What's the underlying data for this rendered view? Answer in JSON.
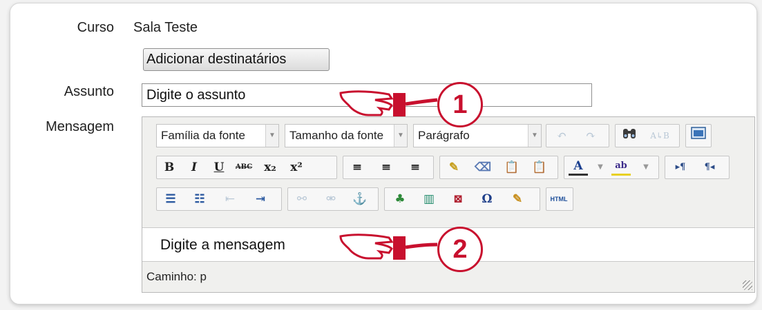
{
  "labels": {
    "course": "Curso",
    "subject": "Assunto",
    "message": "Mensagem"
  },
  "course_value": "Sala Teste",
  "add_recipients_button": "Adicionar destinatários",
  "subject_input": {
    "value": "Digite o assunto"
  },
  "editor": {
    "font_family_select": "Família da fonte",
    "font_size_select": "Tamanho da fonte",
    "paragraph_select": "Parágrafo",
    "buttons": {
      "bold": "B",
      "italic": "I",
      "underline": "U",
      "strikethrough": "ABC",
      "subscript": "x₂",
      "superscript": "x²",
      "html": "HTML",
      "omega": "Ω",
      "font_color": "A",
      "highlight": "ab"
    },
    "content": "Digite a mensagem",
    "path": "Caminho: p"
  },
  "callouts": {
    "one": "1",
    "two": "2"
  },
  "colors": {
    "callout_red": "#c8102e",
    "link_blue": "#1f5fbf"
  }
}
